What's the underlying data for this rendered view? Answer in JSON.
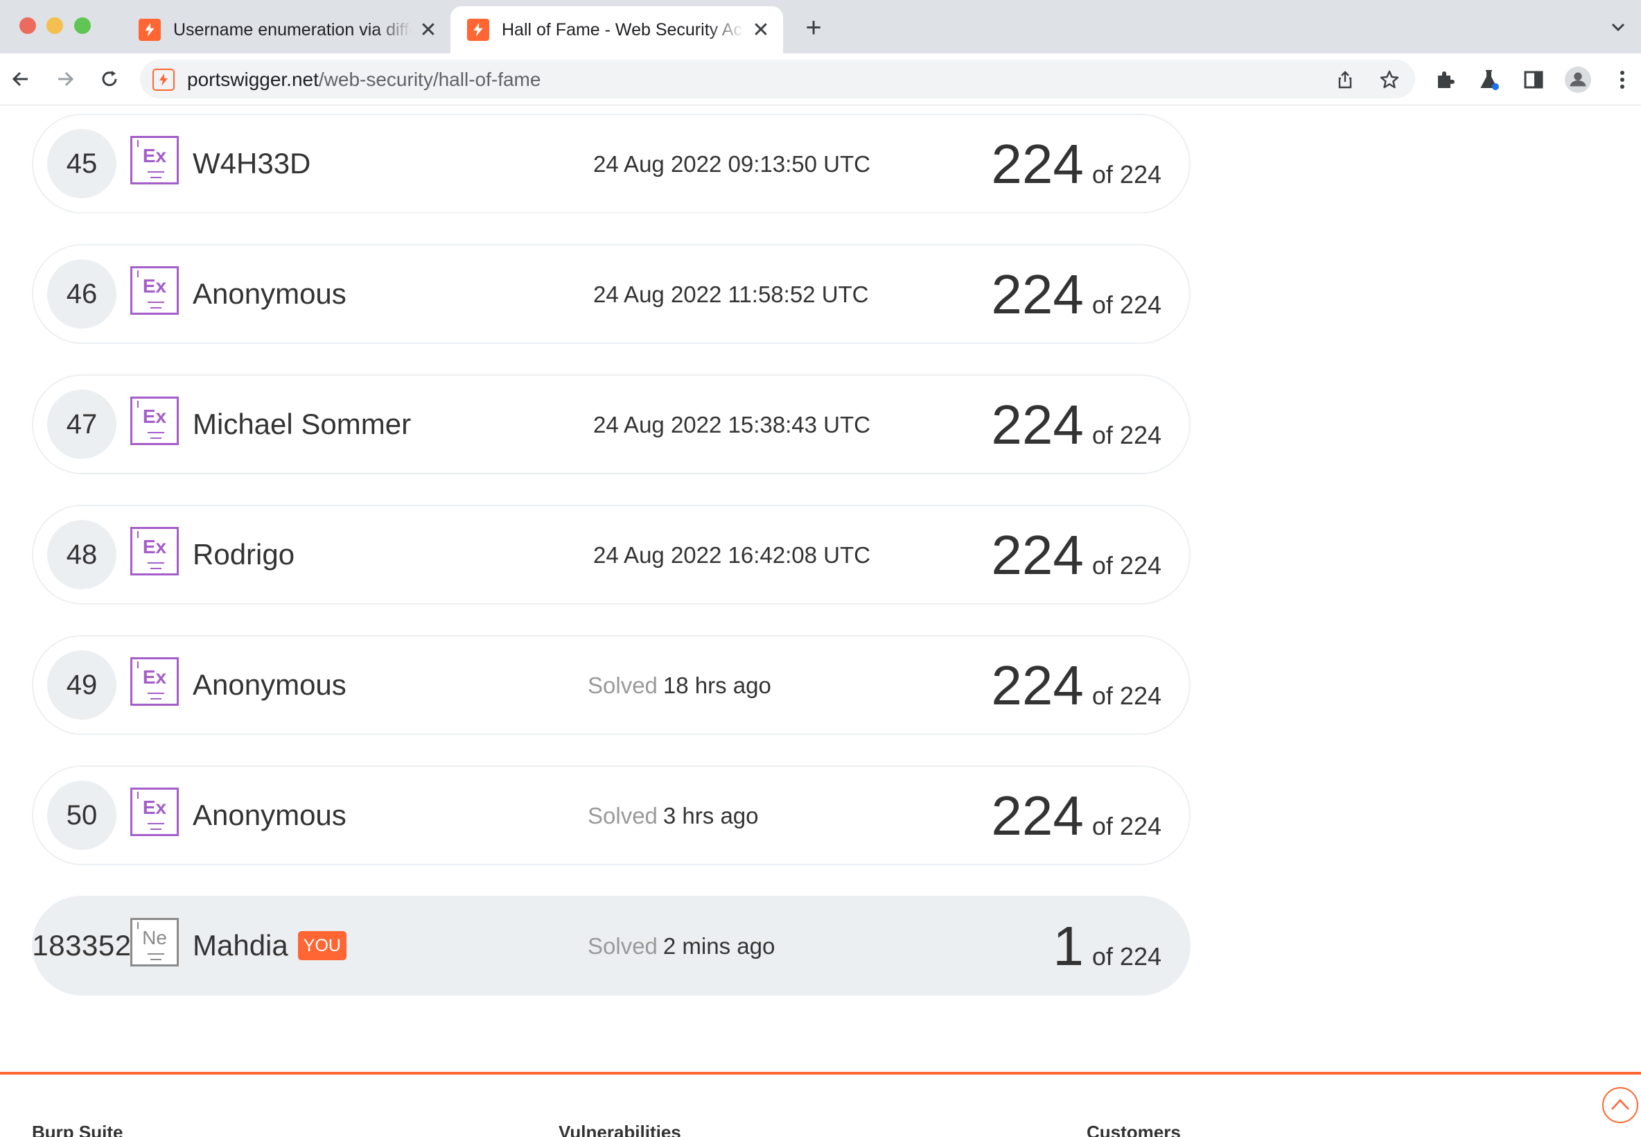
{
  "browser": {
    "tabs": [
      {
        "title": "Username enumeration via different responses",
        "active": false
      },
      {
        "title": "Hall of Fame - Web Security Academy",
        "active": true
      }
    ],
    "address": {
      "domain": "portswigger.net",
      "path": "/web-security/hall-of-fame"
    }
  },
  "leaderboard": {
    "rows": [
      {
        "rank": "45",
        "badge": "Ex",
        "name": "W4H33D",
        "solved_prefix": "",
        "date": "24 Aug 2022 09:13:50 UTC",
        "score": "224",
        "total": "of 224"
      },
      {
        "rank": "46",
        "badge": "Ex",
        "name": "Anonymous",
        "solved_prefix": "",
        "date": "24 Aug 2022 11:58:52 UTC",
        "score": "224",
        "total": "of 224"
      },
      {
        "rank": "47",
        "badge": "Ex",
        "name": "Michael Sommer",
        "solved_prefix": "",
        "date": "24 Aug 2022 15:38:43 UTC",
        "score": "224",
        "total": "of 224"
      },
      {
        "rank": "48",
        "badge": "Ex",
        "name": "Rodrigo",
        "solved_prefix": "",
        "date": "24 Aug 2022 16:42:08 UTC",
        "score": "224",
        "total": "of 224"
      },
      {
        "rank": "49",
        "badge": "Ex",
        "name": "Anonymous",
        "solved_prefix": "Solved",
        "date": "18 hrs ago",
        "score": "224",
        "total": "of 224"
      },
      {
        "rank": "50",
        "badge": "Ex",
        "name": "Anonymous",
        "solved_prefix": "Solved",
        "date": "3 hrs ago",
        "score": "224",
        "total": "of 224"
      }
    ],
    "current_user": {
      "rank": "183352",
      "badge": "Ne",
      "name": "Mahdia",
      "you_label": "YOU",
      "solved_prefix": "Solved",
      "date": "2 mins ago",
      "score": "1",
      "total": "of 224"
    }
  },
  "footer": {
    "columns": [
      "Burp Suite",
      "Vulnerabilities",
      "Customers"
    ]
  },
  "colors": {
    "accent": "#ff6633",
    "expert_badge": "#a45dc9",
    "row_border": "#eceff2"
  }
}
